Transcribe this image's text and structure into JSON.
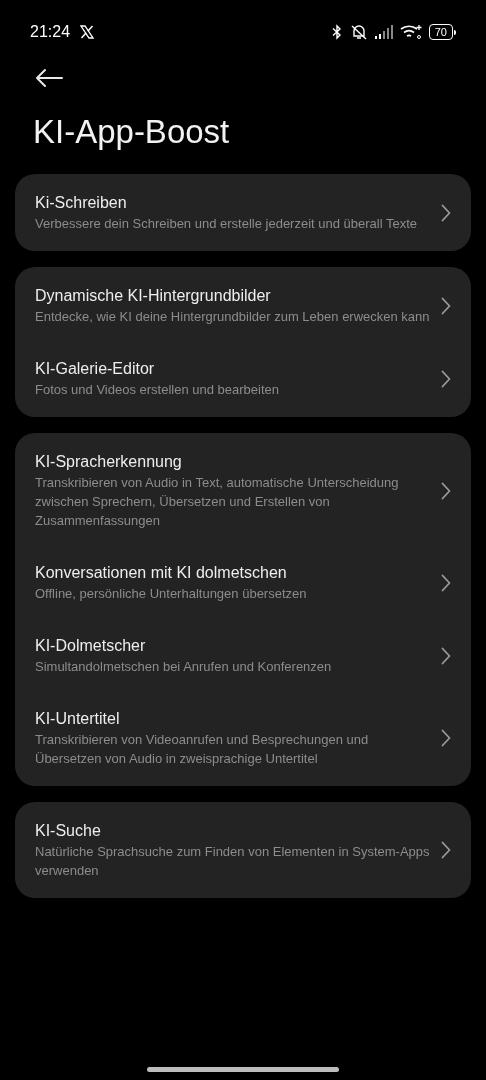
{
  "status_bar": {
    "time": "21:24",
    "battery": "70"
  },
  "title": "KI-App-Boost",
  "groups": [
    {
      "items": [
        {
          "title": "Ki-Schreiben",
          "subtitle": "Verbessere dein Schreiben und erstelle jederzeit und überall Texte"
        }
      ]
    },
    {
      "items": [
        {
          "title": "Dynamische KI-Hintergrundbilder",
          "subtitle": "Entdecke, wie KI deine Hintergrundbilder zum Leben erwecken kann"
        },
        {
          "title": "KI-Galerie-Editor",
          "subtitle": "Fotos und Videos erstellen und bearbeiten"
        }
      ]
    },
    {
      "items": [
        {
          "title": "KI-Spracherkennung",
          "subtitle": "Transkribieren von Audio in Text, automatische Unterscheidung zwischen Sprechern, Übersetzen und Erstellen von Zusammenfassungen"
        },
        {
          "title": "Konversationen mit KI dolmetschen",
          "subtitle": "Offline, persönliche Unterhaltungen übersetzen"
        },
        {
          "title": "KI-Dolmetscher",
          "subtitle": "Simultandolmetschen bei Anrufen und Konferenzen"
        },
        {
          "title": "KI-Untertitel",
          "subtitle": "Transkribieren von Videoanrufen und Besprechungen und Übersetzen von Audio in zweisprachige Untertitel"
        }
      ]
    },
    {
      "items": [
        {
          "title": "KI-Suche",
          "subtitle": "Natürliche Sprachsuche zum Finden von Elementen in System-Apps verwenden"
        }
      ]
    }
  ]
}
